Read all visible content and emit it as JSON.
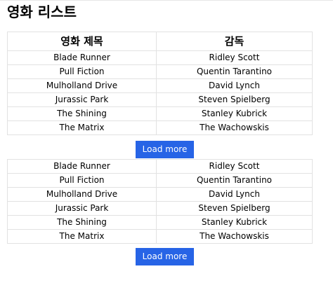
{
  "page": {
    "title": "영화 리스트"
  },
  "table": {
    "headers": [
      "영화 제목",
      "감독"
    ]
  },
  "movies": [
    {
      "title": "Blade Runner",
      "director": "Ridley Scott"
    },
    {
      "title": "Pull Fiction",
      "director": "Quentin Tarantino"
    },
    {
      "title": "Mulholland Drive",
      "director": "David Lynch"
    },
    {
      "title": "Jurassic Park",
      "director": "Steven Spielberg"
    },
    {
      "title": "The Shining",
      "director": "Stanley Kubrick"
    },
    {
      "title": "The Matrix",
      "director": "The Wachowskis"
    }
  ],
  "more_movies": [
    {
      "title": "Blade Runner",
      "director": "Ridley Scott"
    },
    {
      "title": "Pull Fiction",
      "director": "Quentin Tarantino"
    },
    {
      "title": "Mulholland Drive",
      "director": "David Lynch"
    },
    {
      "title": "Jurassic Park",
      "director": "Steven Spielberg"
    },
    {
      "title": "The Shining",
      "director": "Stanley Kubrick"
    },
    {
      "title": "The Matrix",
      "director": "The Wachowskis"
    }
  ],
  "buttons": {
    "load_more_label": "Load more"
  },
  "colors": {
    "button_bg": "#2764e6",
    "button_text": "#ffffff",
    "border": "#e2e2e2"
  }
}
